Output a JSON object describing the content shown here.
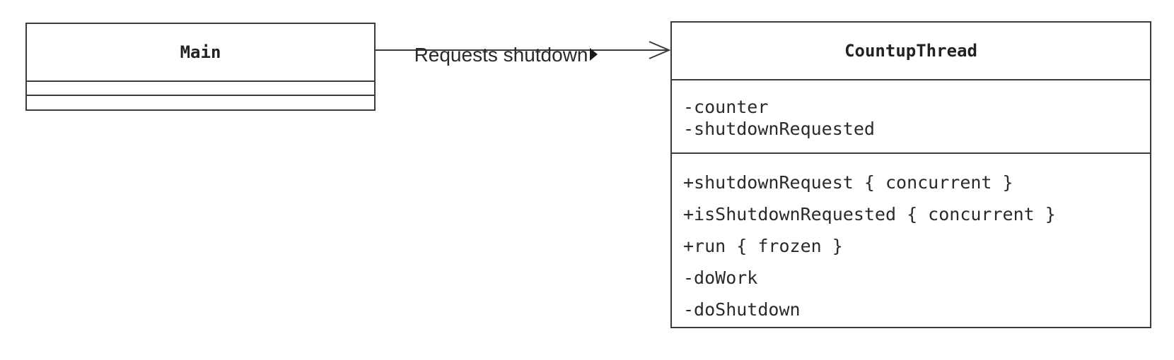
{
  "diagram": {
    "classes": [
      {
        "name": "Main",
        "attributes": [],
        "operations": []
      },
      {
        "name": "CountupThread",
        "attributes": [
          "-counter",
          "-shutdownRequested"
        ],
        "operations": [
          "+shutdownRequest { concurrent }",
          "+isShutdownRequested { concurrent }",
          "+run { frozen }",
          "-doWork",
          "-doShutdown"
        ]
      }
    ],
    "association": {
      "label": "Requests shutdown",
      "from": "Main",
      "to": "CountupThread",
      "navigable_end": "CountupThread"
    }
  },
  "colors": {
    "line": "#3a3a3a",
    "text": "#2a2a2a",
    "background": "#ffffff"
  }
}
